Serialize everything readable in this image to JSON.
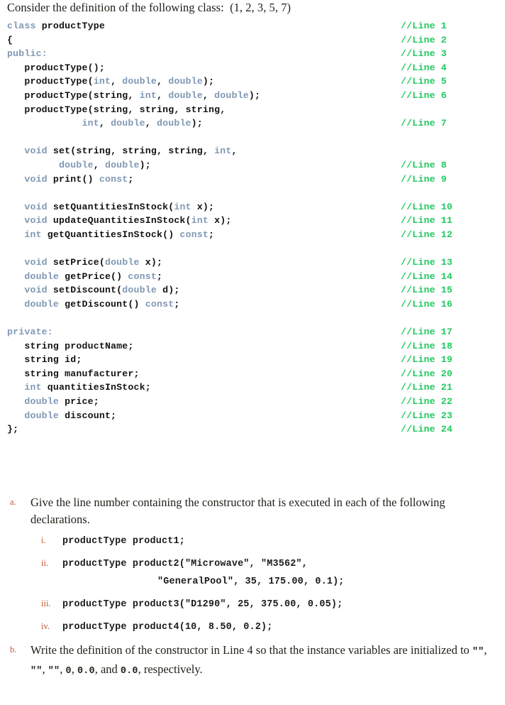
{
  "intro": {
    "text": "Consider the definition of the following class:  (1, 2, 3, 5, 7)"
  },
  "code": {
    "comment_prefix": "//Line ",
    "lines": [
      {
        "comment": "//Line 1",
        "tokens": [
          {
            "t": "class ",
            "c": "kw"
          },
          {
            "t": "productType",
            "c": "id"
          }
        ]
      },
      {
        "comment": "//Line 2",
        "tokens": [
          {
            "t": "{",
            "c": "id"
          }
        ]
      },
      {
        "comment": "//Line 3",
        "tokens": [
          {
            "t": "public",
            "c": "kw"
          },
          {
            "t": ":",
            "c": "kw"
          }
        ]
      },
      {
        "comment": "//Line 4",
        "tokens": [
          {
            "t": "   productType();",
            "c": "id"
          }
        ]
      },
      {
        "comment": "//Line 5",
        "tokens": [
          {
            "t": "   productType(",
            "c": "id"
          },
          {
            "t": "int",
            "c": "kw"
          },
          {
            "t": ", ",
            "c": "id"
          },
          {
            "t": "double",
            "c": "kw"
          },
          {
            "t": ", ",
            "c": "id"
          },
          {
            "t": "double",
            "c": "kw"
          },
          {
            "t": ");",
            "c": "id"
          }
        ]
      },
      {
        "comment": "//Line 6",
        "tokens": [
          {
            "t": "   productType(",
            "c": "id"
          },
          {
            "t": "string",
            "c": "id"
          },
          {
            "t": ", ",
            "c": "id"
          },
          {
            "t": "int",
            "c": "kw"
          },
          {
            "t": ", ",
            "c": "id"
          },
          {
            "t": "double",
            "c": "kw"
          },
          {
            "t": ", ",
            "c": "id"
          },
          {
            "t": "double",
            "c": "kw"
          },
          {
            "t": ");",
            "c": "id"
          }
        ]
      },
      {
        "comment": "",
        "tokens": [
          {
            "t": "   productType(",
            "c": "id"
          },
          {
            "t": "string",
            "c": "id"
          },
          {
            "t": ", ",
            "c": "id"
          },
          {
            "t": "string",
            "c": "id"
          },
          {
            "t": ", ",
            "c": "id"
          },
          {
            "t": "string",
            "c": "id"
          },
          {
            "t": ",",
            "c": "id"
          }
        ]
      },
      {
        "comment": "//Line 7",
        "tokens": [
          {
            "t": "             ",
            "c": "id"
          },
          {
            "t": "int",
            "c": "kw"
          },
          {
            "t": ", ",
            "c": "id"
          },
          {
            "t": "double",
            "c": "kw"
          },
          {
            "t": ", ",
            "c": "id"
          },
          {
            "t": "double",
            "c": "kw"
          },
          {
            "t": ");",
            "c": "id"
          }
        ]
      },
      {
        "comment": "",
        "tokens": []
      },
      {
        "comment": "",
        "tokens": [
          {
            "t": "   ",
            "c": "id"
          },
          {
            "t": "void",
            "c": "kw"
          },
          {
            "t": " set(",
            "c": "id"
          },
          {
            "t": "string",
            "c": "id"
          },
          {
            "t": ", ",
            "c": "id"
          },
          {
            "t": "string",
            "c": "id"
          },
          {
            "t": ", ",
            "c": "id"
          },
          {
            "t": "string",
            "c": "id"
          },
          {
            "t": ", ",
            "c": "id"
          },
          {
            "t": "int",
            "c": "kw"
          },
          {
            "t": ",",
            "c": "id"
          }
        ]
      },
      {
        "comment": "//Line 8",
        "tokens": [
          {
            "t": "         ",
            "c": "id"
          },
          {
            "t": "double",
            "c": "kw"
          },
          {
            "t": ", ",
            "c": "id"
          },
          {
            "t": "double",
            "c": "kw"
          },
          {
            "t": ");",
            "c": "id"
          }
        ]
      },
      {
        "comment": "//Line 9",
        "tokens": [
          {
            "t": "   ",
            "c": "id"
          },
          {
            "t": "void",
            "c": "kw"
          },
          {
            "t": " print() ",
            "c": "id"
          },
          {
            "t": "const",
            "c": "kw"
          },
          {
            "t": ";",
            "c": "id"
          }
        ]
      },
      {
        "comment": "",
        "tokens": []
      },
      {
        "comment": "//Line 10",
        "tokens": [
          {
            "t": "   ",
            "c": "id"
          },
          {
            "t": "void",
            "c": "kw"
          },
          {
            "t": " setQuantitiesInStock(",
            "c": "id"
          },
          {
            "t": "int",
            "c": "kw"
          },
          {
            "t": " x);",
            "c": "id"
          }
        ]
      },
      {
        "comment": "//Line 11",
        "tokens": [
          {
            "t": "   ",
            "c": "id"
          },
          {
            "t": "void",
            "c": "kw"
          },
          {
            "t": " updateQuantitiesInStock(",
            "c": "id"
          },
          {
            "t": "int",
            "c": "kw"
          },
          {
            "t": " x);",
            "c": "id"
          }
        ]
      },
      {
        "comment": "//Line 12",
        "tokens": [
          {
            "t": "   ",
            "c": "id"
          },
          {
            "t": "int",
            "c": "kw"
          },
          {
            "t": " getQuantitiesInStock() ",
            "c": "id"
          },
          {
            "t": "const",
            "c": "kw"
          },
          {
            "t": ";",
            "c": "id"
          }
        ]
      },
      {
        "comment": "",
        "tokens": []
      },
      {
        "comment": "//Line 13",
        "tokens": [
          {
            "t": "   ",
            "c": "id"
          },
          {
            "t": "void",
            "c": "kw"
          },
          {
            "t": " setPrice(",
            "c": "id"
          },
          {
            "t": "double",
            "c": "kw"
          },
          {
            "t": " x);",
            "c": "id"
          }
        ]
      },
      {
        "comment": "//Line 14",
        "tokens": [
          {
            "t": "   ",
            "c": "id"
          },
          {
            "t": "double",
            "c": "kw"
          },
          {
            "t": " getPrice() ",
            "c": "id"
          },
          {
            "t": "const",
            "c": "kw"
          },
          {
            "t": ";",
            "c": "id"
          }
        ]
      },
      {
        "comment": "//Line 15",
        "tokens": [
          {
            "t": "   ",
            "c": "id"
          },
          {
            "t": "void",
            "c": "kw"
          },
          {
            "t": " setDiscount(",
            "c": "id"
          },
          {
            "t": "double",
            "c": "kw"
          },
          {
            "t": " d);",
            "c": "id"
          }
        ]
      },
      {
        "comment": "//Line 16",
        "tokens": [
          {
            "t": "   ",
            "c": "id"
          },
          {
            "t": "double",
            "c": "kw"
          },
          {
            "t": " getDiscount() ",
            "c": "id"
          },
          {
            "t": "const",
            "c": "kw"
          },
          {
            "t": ";",
            "c": "id"
          }
        ]
      },
      {
        "comment": "",
        "tokens": []
      },
      {
        "comment": "//Line 17",
        "tokens": [
          {
            "t": "private",
            "c": "kw"
          },
          {
            "t": ":",
            "c": "kw"
          }
        ]
      },
      {
        "comment": "//Line 18",
        "tokens": [
          {
            "t": "   ",
            "c": "id"
          },
          {
            "t": "string",
            "c": "id"
          },
          {
            "t": " productName;",
            "c": "id"
          }
        ]
      },
      {
        "comment": "//Line 19",
        "tokens": [
          {
            "t": "   ",
            "c": "id"
          },
          {
            "t": "string",
            "c": "id"
          },
          {
            "t": " id;",
            "c": "id"
          }
        ]
      },
      {
        "comment": "//Line 20",
        "tokens": [
          {
            "t": "   ",
            "c": "id"
          },
          {
            "t": "string",
            "c": "id"
          },
          {
            "t": " manufacturer;",
            "c": "id"
          }
        ]
      },
      {
        "comment": "//Line 21",
        "tokens": [
          {
            "t": "   ",
            "c": "id"
          },
          {
            "t": "int",
            "c": "kw"
          },
          {
            "t": " quantitiesInStock;",
            "c": "id"
          }
        ]
      },
      {
        "comment": "//Line 22",
        "tokens": [
          {
            "t": "   ",
            "c": "id"
          },
          {
            "t": "double",
            "c": "kw"
          },
          {
            "t": " price;",
            "c": "id"
          }
        ]
      },
      {
        "comment": "//Line 23",
        "tokens": [
          {
            "t": "   ",
            "c": "id"
          },
          {
            "t": "double",
            "c": "kw"
          },
          {
            "t": " discount;",
            "c": "id"
          }
        ]
      },
      {
        "comment": "//Line 24",
        "tokens": [
          {
            "t": "};",
            "c": "id"
          }
        ]
      }
    ]
  },
  "questions": {
    "a": {
      "marker": "a.",
      "text": "Give the line number containing the constructor that is executed in each of the following declarations.",
      "subitems": [
        {
          "marker": "i.",
          "code": "productType product1;",
          "continuation": ""
        },
        {
          "marker": "ii.",
          "code": "productType product2(\"Microwave\", \"M3562\",",
          "continuation": "\"GeneralPool\", 35, 175.00, 0.1);"
        },
        {
          "marker": "iii.",
          "code": "productType product3(\"D1290\", 25, 375.00, 0.05);",
          "continuation": ""
        },
        {
          "marker": "iv.",
          "code": "productType product4(10, 8.50, 0.2);",
          "continuation": ""
        }
      ]
    },
    "b": {
      "marker": "b.",
      "part1": "Write the definition of the constructor in Line 4 so that the instance variables are initialized to ",
      "code1": "\"\"",
      "sep1": ", ",
      "code2": "\"\"",
      "sep2": ", ",
      "code3": "\"\"",
      "sep3": ", ",
      "code4": "0",
      "sep4": ", ",
      "code5": "0.0",
      "sep5": ", and ",
      "code6": "0.0",
      "part2": ", respectively."
    }
  },
  "colors": {
    "keyword": "#8098b4",
    "comment": "#22c95f",
    "marker": "#c5522a",
    "text": "#231f18",
    "code": "#1a1a1a",
    "background": "#ffffff"
  }
}
